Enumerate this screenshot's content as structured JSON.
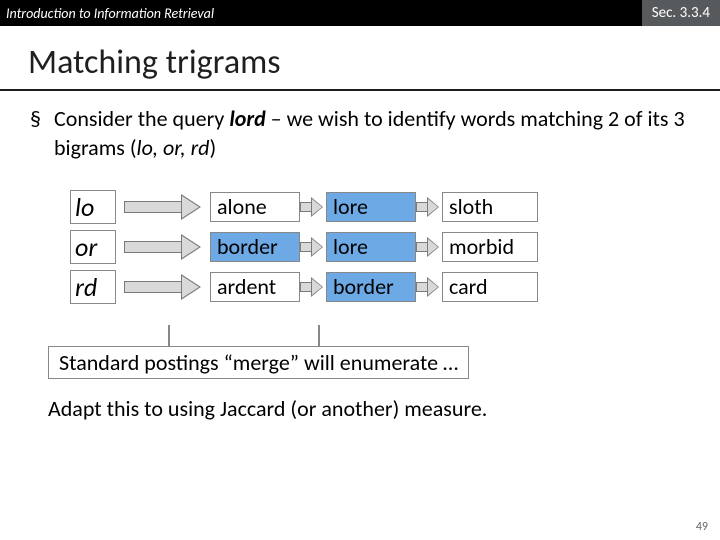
{
  "header": {
    "course": "Introduction to Information Retrieval",
    "section": "Sec. 3.3.4"
  },
  "title": "Matching trigrams",
  "bullet": {
    "pre": "Consider the query ",
    "q": "lord",
    "mid": " – we wish to identify words matching 2 of its 3 bigrams (",
    "bg": "lo, or, rd",
    "post": ")"
  },
  "rows": [
    {
      "bigram": "lo",
      "c1": "alone",
      "c2": "lore",
      "c3": "sloth",
      "hl": [
        false,
        true,
        false
      ]
    },
    {
      "bigram": "or",
      "c1": "border",
      "c2": "lore",
      "c3": "morbid",
      "hl": [
        true,
        true,
        false
      ]
    },
    {
      "bigram": "rd",
      "c1": "ardent",
      "c2": "border",
      "c3": "card",
      "hl": [
        false,
        true,
        false
      ]
    }
  ],
  "merge": "Standard postings “merge” will enumerate …",
  "adapt": "Adapt this to using Jaccard (or another) measure.",
  "pagenum": "49"
}
